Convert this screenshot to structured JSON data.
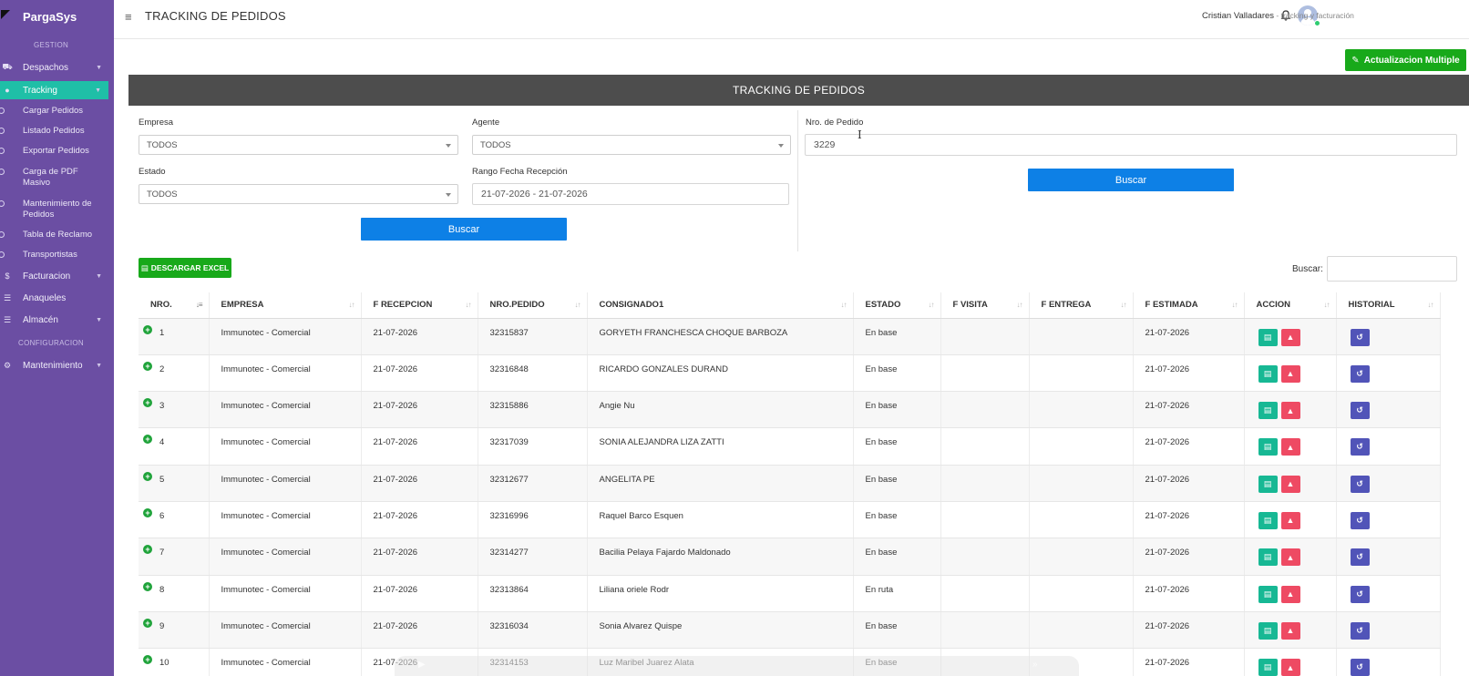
{
  "sidebar": {
    "brand": "PargaSys",
    "heading_gestion": "GESTION",
    "heading_config": "CONFIGURACION",
    "items": [
      {
        "label": "Despachos",
        "icon": "truck-icon"
      },
      {
        "label": "Tracking",
        "icon": "map-marker-icon"
      },
      {
        "label": "Facturacion",
        "icon": "dollar-icon"
      },
      {
        "label": "Anaqueles",
        "icon": "list-icon"
      },
      {
        "label": "Almacén",
        "icon": "list-icon"
      },
      {
        "label": "Mantenimiento",
        "icon": "gear-icon"
      }
    ],
    "tracking_sub": [
      "Cargar Pedidos",
      "Listado Pedidos",
      "Exportar Pedidos",
      "Carga de PDF Masivo",
      "Mantenimiento de Pedidos",
      "Tabla de Reclamo",
      "Transportistas"
    ]
  },
  "topbar": {
    "title": "TRACKING DE PEDIDOS",
    "user_name": "Cristian Valladares",
    "user_role": " - tracking y facturación"
  },
  "actions": {
    "multi_update": "Actualizacion Multiple",
    "download_excel": "DESCARGAR EXCEL"
  },
  "card_title": "TRACKING DE PEDIDOS",
  "filters": {
    "empresa_label": "Empresa",
    "empresa_value": "TODOS",
    "agente_label": "Agente",
    "agente_value": "TODOS",
    "estado_label": "Estado",
    "estado_value": "TODOS",
    "rango_label": "Rango Fecha Recepción",
    "rango_value": "21-07-2026 - 21-07-2026",
    "buscar": "Buscar",
    "pedido_label": "Nro. de Pedido",
    "pedido_value": "3229",
    "buscar_pedido": "Buscar"
  },
  "search": {
    "label": "Buscar:"
  },
  "table": {
    "columns": [
      "NRO.",
      "EMPRESA",
      "F RECEPCION",
      "NRO.PEDIDO",
      "CONSIGNADO1",
      "ESTADO",
      "F VISITA",
      "F ENTREGA",
      "F ESTIMADA",
      "ACCION",
      "HISTORIAL"
    ],
    "rows": [
      {
        "nro": "1",
        "empresa": "Immunotec - Comercial",
        "f_recepcion": "21-07-2026",
        "pedido": "32315837",
        "consignado": "GORYETH FRANCHESCA CHOQUE BARBOZA",
        "estado": "En base",
        "f_visita": "",
        "f_entrega": "",
        "f_estimada": "21-07-2026"
      },
      {
        "nro": "2",
        "empresa": "Immunotec - Comercial",
        "f_recepcion": "21-07-2026",
        "pedido": "32316848",
        "consignado": "RICARDO GONZALES DURAND",
        "estado": "En base",
        "f_visita": "",
        "f_entrega": "",
        "f_estimada": "21-07-2026"
      },
      {
        "nro": "3",
        "empresa": "Immunotec - Comercial",
        "f_recepcion": "21-07-2026",
        "pedido": "32315886",
        "consignado": "Angie Nu",
        "estado": "En base",
        "f_visita": "",
        "f_entrega": "",
        "f_estimada": "21-07-2026"
      },
      {
        "nro": "4",
        "empresa": "Immunotec - Comercial",
        "f_recepcion": "21-07-2026",
        "pedido": "32317039",
        "consignado": "SONIA ALEJANDRA LIZA ZATTI",
        "estado": "En base",
        "f_visita": "",
        "f_entrega": "",
        "f_estimada": "21-07-2026"
      },
      {
        "nro": "5",
        "empresa": "Immunotec - Comercial",
        "f_recepcion": "21-07-2026",
        "pedido": "32312677",
        "consignado": "ANGELITA PE",
        "estado": "En base",
        "f_visita": "",
        "f_entrega": "",
        "f_estimada": "21-07-2026"
      },
      {
        "nro": "6",
        "empresa": "Immunotec - Comercial",
        "f_recepcion": "21-07-2026",
        "pedido": "32316996",
        "consignado": "Raquel Barco Esquen",
        "estado": "En base",
        "f_visita": "",
        "f_entrega": "",
        "f_estimada": "21-07-2026"
      },
      {
        "nro": "7",
        "empresa": "Immunotec - Comercial",
        "f_recepcion": "21-07-2026",
        "pedido": "32314277",
        "consignado": "Bacilia Pelaya Fajardo Maldonado",
        "estado": "En base",
        "f_visita": "",
        "f_entrega": "",
        "f_estimada": "21-07-2026"
      },
      {
        "nro": "8",
        "empresa": "Immunotec - Comercial",
        "f_recepcion": "21-07-2026",
        "pedido": "32313864",
        "consignado": "Liliana oriele Rodr",
        "estado": "En ruta",
        "f_visita": "",
        "f_entrega": "",
        "f_estimada": "21-07-2026"
      },
      {
        "nro": "9",
        "empresa": "Immunotec - Comercial",
        "f_recepcion": "21-07-2026",
        "pedido": "32316034",
        "consignado": "Sonia Alvarez Quispe",
        "estado": "En base",
        "f_visita": "",
        "f_entrega": "",
        "f_estimada": "21-07-2026"
      },
      {
        "nro": "10",
        "empresa": "Immunotec - Comercial",
        "f_recepcion": "21-07-2026",
        "pedido": "32314153",
        "consignado": "Luz Maribel Juarez Alata",
        "estado": "En base",
        "f_visita": "",
        "f_entrega": "",
        "f_estimada": "21-07-2026"
      }
    ]
  },
  "colors": {
    "sidebar": "#6b4ea3",
    "active": "#1fbfa7",
    "green": "#18a91a",
    "blue": "#0d80e6",
    "header": "#4d4d4d",
    "danger": "#ee4a63",
    "history": "#5154b8"
  }
}
